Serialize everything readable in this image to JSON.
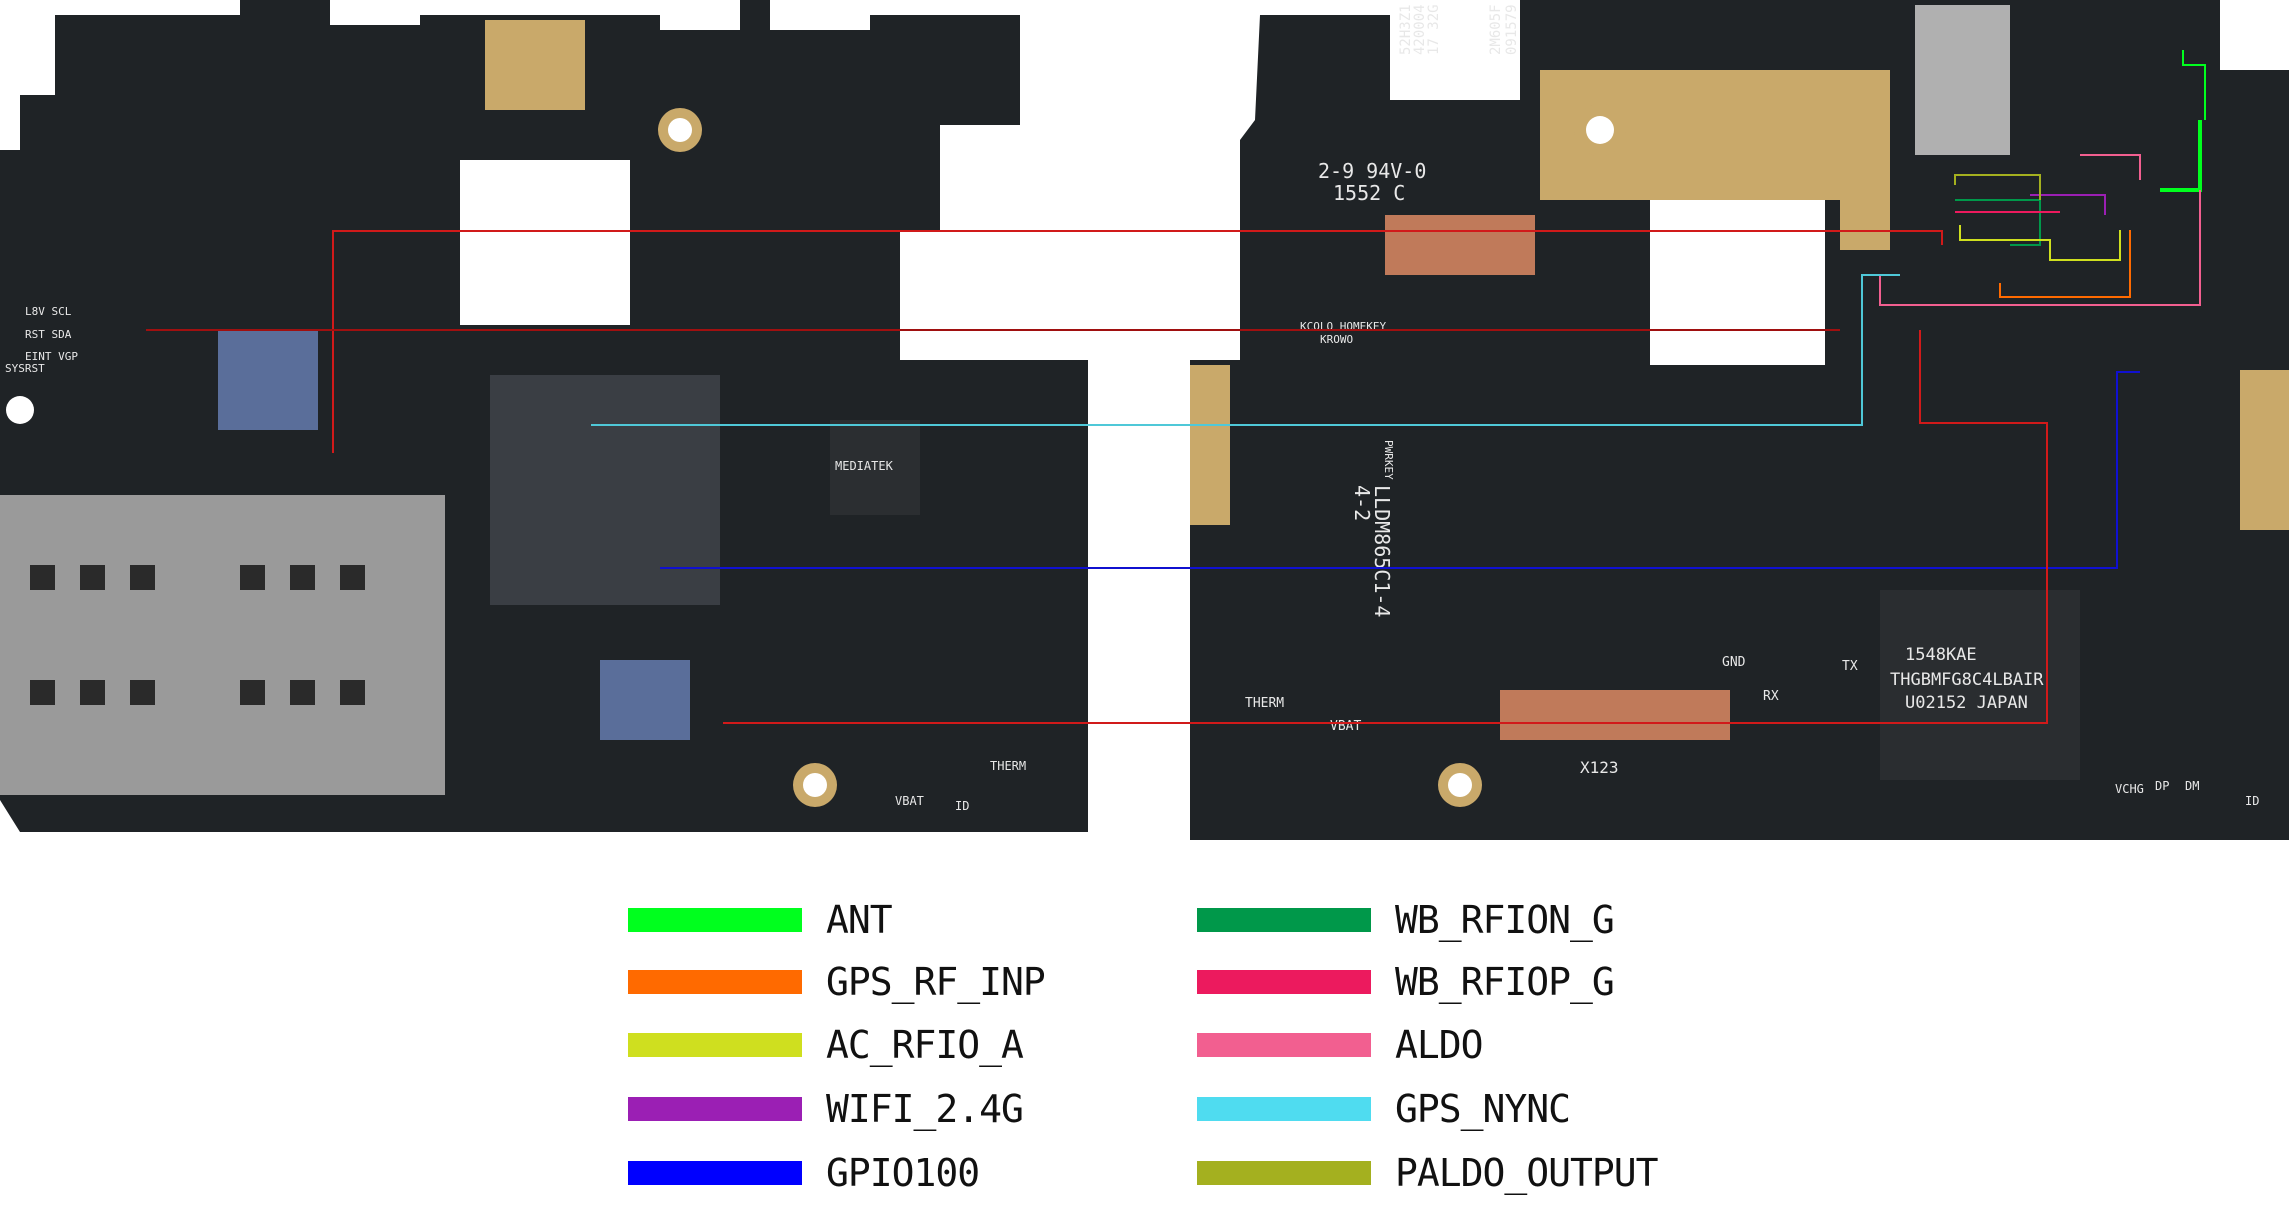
{
  "legend": [
    {
      "label": "ANT",
      "color": "#00ff1e"
    },
    {
      "label": "GPS_RF_INP",
      "color": "#ff6a00"
    },
    {
      "label": "AC_RFIO_A",
      "color": "#cfdf1f"
    },
    {
      "label": "WIFI_2.4G",
      "color": "#9b1fb4"
    },
    {
      "label": "GPIO100",
      "color": "#0000ff"
    },
    {
      "label": "WB_RFION_G",
      "color": "#00984a"
    },
    {
      "label": "WB_RFIOP_G",
      "color": "#ec1a5e"
    },
    {
      "label": "ALDO",
      "color": "#f25f90"
    },
    {
      "label": "GPS_NYNC",
      "color": "#4fdcf0"
    },
    {
      "label": "PALDO_OUTPUT",
      "color": "#a4b01f"
    }
  ],
  "trace_colors": {
    "red": "#d11a1a",
    "dark_red": "#a01010",
    "cyan": "#4fc8d8",
    "blue": "#1010d0"
  },
  "board_colors": {
    "pcb": "#1f2326",
    "gold": "#c9a96a",
    "pad": "#d8c07a"
  },
  "left_board": {
    "labels": [
      "L8V SCL",
      "RST SDA",
      "EINT VGP",
      "SYSRST",
      "MEDIATEK",
      "VBAT",
      "ID",
      "THERM"
    ]
  },
  "right_board": {
    "labels": [
      "2-9 94V-0",
      "1552 C",
      "52H3Z1",
      "420004",
      "17 32G",
      "2M605F",
      "091579",
      "KCOLO HOMEKEY",
      "KROWO",
      "PWRKEY",
      "LLDM865C1-4",
      "4-2",
      "GND",
      "RX",
      "TX",
      "THERM",
      "VBAT",
      "X123",
      "1548KAE",
      "THGBMFG8C4LBAIR",
      "U02152 JAPAN",
      "VCHG",
      "DP",
      "DM",
      "ID"
    ]
  }
}
